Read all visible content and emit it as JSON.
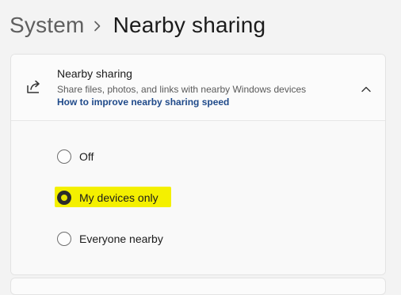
{
  "breadcrumb": {
    "parent": "System",
    "current": "Nearby sharing"
  },
  "card": {
    "title": "Nearby sharing",
    "description": "Share files, photos, and links with nearby Windows devices",
    "link": "How to improve nearby sharing speed",
    "icon": "share-icon",
    "expanded": true
  },
  "options": [
    {
      "label": "Off",
      "selected": false
    },
    {
      "label": "My devices only",
      "selected": true
    },
    {
      "label": "Everyone nearby",
      "selected": false
    }
  ],
  "colors": {
    "accent_link": "#1f4a8a",
    "highlight": "#f4f000",
    "selected_radio": "#2b2b2b"
  }
}
